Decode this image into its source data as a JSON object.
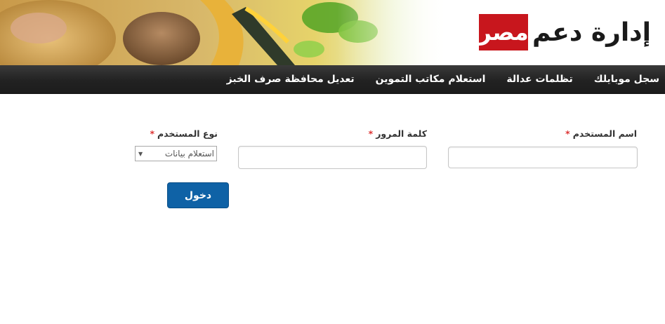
{
  "logo": {
    "box_text": "مصر",
    "main_text": "إدارة دعم",
    "box_color": "#c8161d"
  },
  "nav": {
    "items": [
      {
        "label": "سجل موبايلك"
      },
      {
        "label": "تظلمات عدالة"
      },
      {
        "label": "استعلام مكاتب التموين"
      },
      {
        "label": "تعديل محافظة صرف الخبز"
      }
    ]
  },
  "form": {
    "username": {
      "label": "اسم المستخدم",
      "required_mark": "*",
      "value": ""
    },
    "password": {
      "label": "كلمة المرور",
      "required_mark": "*",
      "value": ""
    },
    "user_type": {
      "label": "نوع المستخدم",
      "required_mark": "*",
      "selected": "استعلام بيانات",
      "arrow": "▼"
    },
    "submit_label": "دخول"
  },
  "colors": {
    "accent": "#0f62a6",
    "nav_bg": "#222222",
    "required": "#dd3333"
  }
}
